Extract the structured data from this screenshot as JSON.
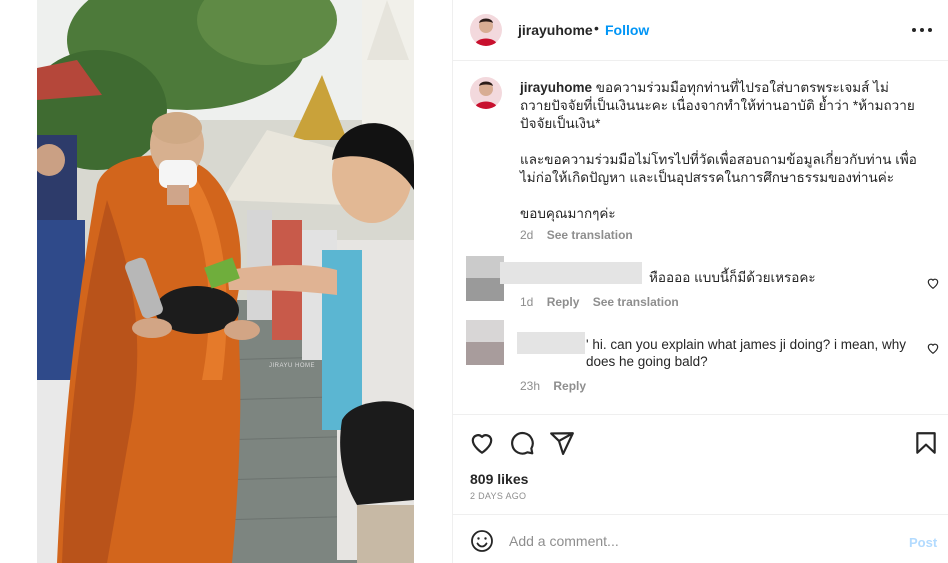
{
  "post": {
    "username": "jirayuhome",
    "separator": "•",
    "follow_label": "Follow",
    "more_icon": "more-options-icon"
  },
  "caption": {
    "username": "jirayuhome",
    "line1": "ขอความร่วมมือทุกท่านที่ไปรอใส่บาตรพระเจมส์ ไม่ถวายปัจจัยที่เป็นเงินนะคะ เนื่องจากทำให้ท่านอาบัติ ย้ำว่า *ห้ามถวายปัจจัยเป็นเงิน*",
    "line2": "และขอความร่วมมือไม่โทรไปที่วัดเพื่อสอบถามข้อมูลเกี่ยวกับท่าน เพื่อไม่ก่อให้เกิดปัญหา และเป็นอุปสรรคในการศึกษาธรรมของท่านค่ะ",
    "line3": "ขอบคุณมากๆค่ะ",
    "time": "2d",
    "see_translation": "See translation"
  },
  "comments": [
    {
      "text": "หืออออ แบบนี้ก็มีด้วยเหรอคะ",
      "time": "1d",
      "reply": "Reply",
      "see_translation": "See translation"
    },
    {
      "text": "' hi. can you explain what james ji doing? i mean, why does he going bald?",
      "time": "23h",
      "reply": "Reply"
    }
  ],
  "actions": {
    "icons": [
      "like-icon",
      "comment-icon",
      "share-icon",
      "save-icon"
    ],
    "likes": "809 likes",
    "time_ago": "2 DAYS AGO"
  },
  "comment_box": {
    "placeholder": "Add a comment...",
    "post_label": "Post",
    "emoji_icon": "emoji-icon"
  },
  "photo": {
    "watermark": "JIRAYU HOME"
  },
  "colors": {
    "link_blue": "#0095f6",
    "post_disabled": "#b3dbff",
    "border": "#efefef",
    "muted": "#8e8e8e",
    "robe": "#d2651c"
  }
}
